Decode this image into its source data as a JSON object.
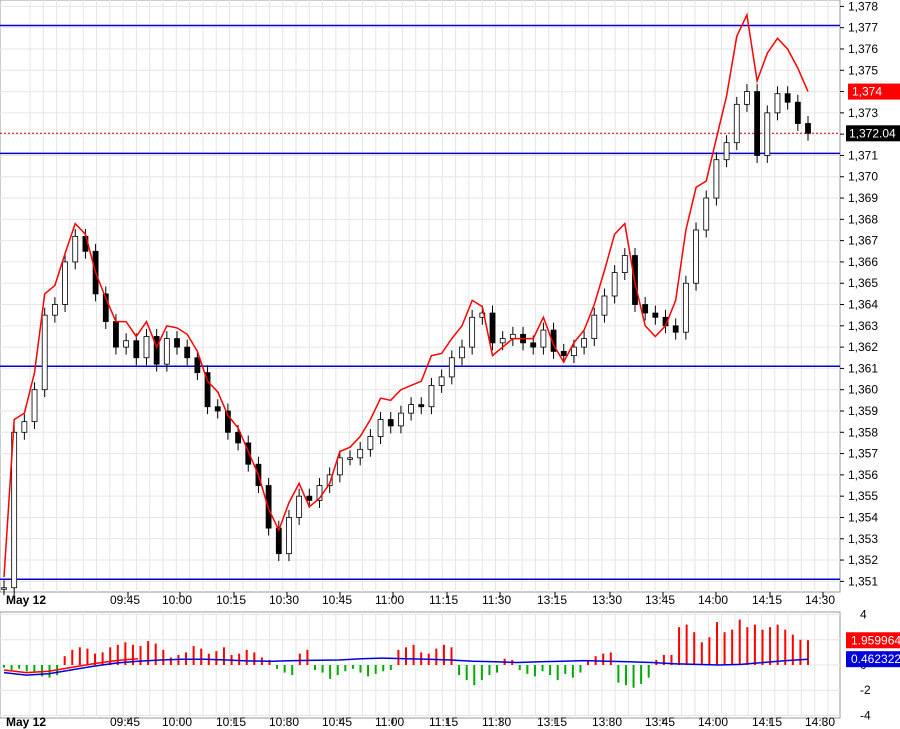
{
  "chart_data": [
    {
      "type": "candlestick",
      "date_label": "May 12",
      "x_ticks": [
        "09:45",
        "10:00",
        "10:15",
        "10:30",
        "10:45",
        "11:00",
        "11:15",
        "11:30",
        "13:15",
        "13:30",
        "13:45",
        "14:00",
        "14:15",
        "14:30"
      ],
      "y_ticks": [
        "1,351",
        "1,352",
        "1,353",
        "1,354",
        "1,355",
        "1,356",
        "1,357",
        "1,358",
        "1,359",
        "1,360",
        "1,361",
        "1,362",
        "1,363",
        "1,364",
        "1,365",
        "1,366",
        "1,367",
        "1,368",
        "1,369",
        "1,370",
        "1,371",
        "1,372",
        "1,373",
        "1,374",
        "1,375",
        "1,376",
        "1,377",
        "1,378"
      ],
      "ylim": [
        1350.5,
        1378.3
      ],
      "horizontal_lines": [
        1377.1,
        1371.1,
        1361.1,
        1351.1
      ],
      "last_price_label": "1,372.04",
      "last_price": 1372.04,
      "red_line_label": "1,374",
      "red_line_value": 1374.0,
      "price_path": [
        1350.7,
        1358.0,
        1358.5,
        1360.0,
        1363.5,
        1364.0,
        1366.0,
        1367.2,
        1366.5,
        1364.5,
        1363.2,
        1362.0,
        1362.3,
        1361.5,
        1362.5,
        1361.2,
        1362.4,
        1362.0,
        1361.5,
        1360.8,
        1359.2,
        1359.0,
        1358.0,
        1357.5,
        1356.5,
        1355.5,
        1353.5,
        1352.3,
        1354.0,
        1355.0,
        1354.8,
        1355.5,
        1356.0,
        1356.8,
        1356.8,
        1357.2,
        1357.8,
        1358.6,
        1358.3,
        1358.9,
        1359.3,
        1359.2,
        1360.2,
        1360.6,
        1361.5,
        1362.0,
        1363.4,
        1363.6,
        1362.2,
        1362.4,
        1362.6,
        1362.2,
        1362.0,
        1362.8,
        1361.8,
        1361.6,
        1362.0,
        1362.4,
        1363.5,
        1364.4,
        1365.5,
        1366.3,
        1364.0,
        1363.6,
        1363.4,
        1363.0,
        1362.7,
        1365.0,
        1367.5,
        1369.0,
        1370.8,
        1371.6,
        1373.4,
        1374.0,
        1371.0,
        1373.0,
        1373.9,
        1373.5,
        1372.5,
        1372.04
      ],
      "indicator": {
        "yticks": [
          "4",
          "2",
          "0",
          "-2",
          "-4"
        ],
        "ylim": [
          -4.2,
          4.2
        ],
        "histogram_label": "1.959964",
        "histogram_value": 1.959964,
        "signal_label": "0.462322",
        "signal_value": 0.462322,
        "histogram": [
          -0.2,
          -0.4,
          -0.3,
          -0.5,
          -0.6,
          -0.9,
          -1.0,
          -0.8,
          0.7,
          1.2,
          1.4,
          1.3,
          0.9,
          1.0,
          1.4,
          1.6,
          1.8,
          1.6,
          1.5,
          1.9,
          1.7,
          1.2,
          0.6,
          0.8,
          1.0,
          1.5,
          1.3,
          0.9,
          1.1,
          1.4,
          0.8,
          0.9,
          1.2,
          1.0,
          0.6,
          0.4,
          -0.3,
          -0.6,
          -0.8,
          0.9,
          1.2,
          -0.4,
          -0.6,
          -1.1,
          -0.8,
          -0.5,
          -0.3,
          -0.6,
          -0.9,
          -0.7,
          -0.5,
          -0.4,
          1.2,
          1.4,
          1.6,
          1.0,
          0.9,
          1.3,
          1.6,
          1.4,
          -0.8,
          -1.2,
          -1.6,
          -1.2,
          -0.8,
          -0.6,
          0.5,
          0.4,
          -0.4,
          -0.7,
          -0.9,
          -0.5,
          -0.8,
          -1.2,
          -0.7,
          -1.0,
          -0.6,
          0.4,
          0.7,
          0.9,
          1.0,
          -1.4,
          -1.6,
          -1.8,
          -1.5,
          -1.0,
          0.4,
          0.8,
          0.8,
          3.0,
          3.2,
          2.6,
          1.8,
          2.2,
          3.4,
          2.6,
          2.8,
          3.6,
          3.0,
          3.2,
          2.8,
          3.0,
          3.2,
          2.8,
          2.4,
          2.0,
          1.96
        ],
        "signal": [
          -0.6,
          -0.8,
          -0.7,
          -0.4,
          -0.1,
          0.15,
          0.3,
          0.4,
          0.45,
          0.46,
          0.4,
          0.32,
          0.3,
          0.35,
          0.38,
          0.4,
          0.5,
          0.55,
          0.5,
          0.45,
          0.4,
          0.3,
          0.25,
          0.2,
          0.25,
          0.3,
          0.35,
          0.3,
          0.25,
          0.2,
          0.1,
          0.05,
          0.0,
          0.05,
          0.2,
          0.35,
          0.46
        ]
      }
    }
  ]
}
